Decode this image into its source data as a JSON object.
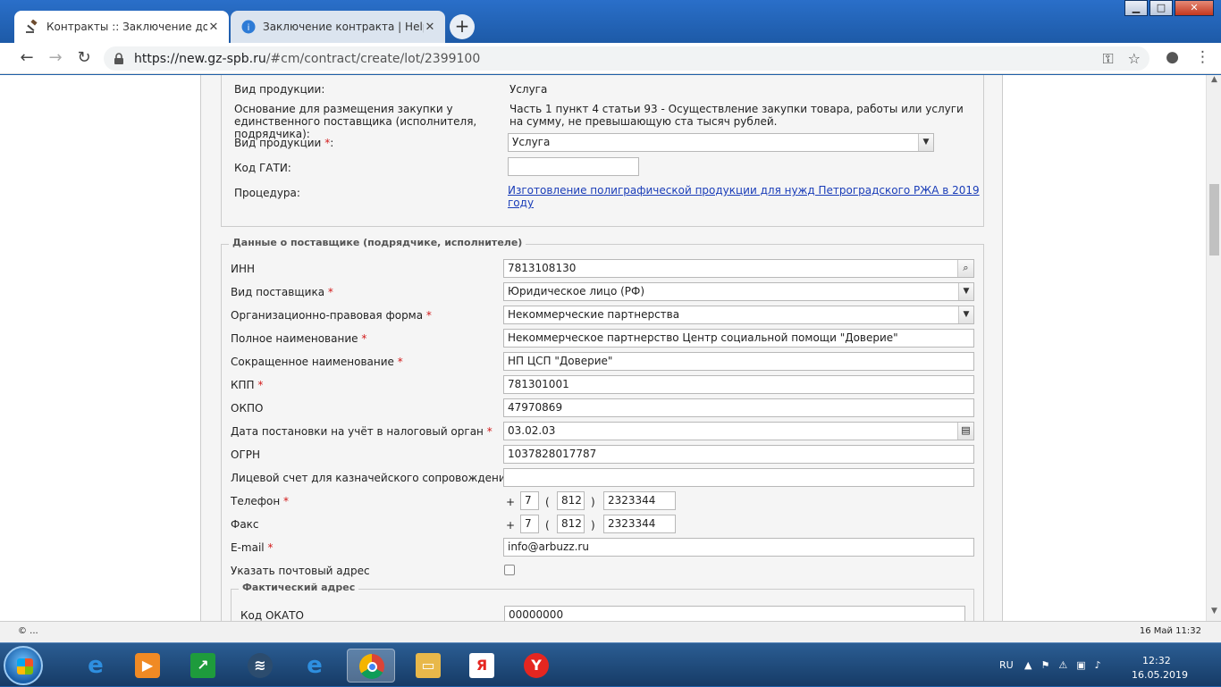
{
  "browser": {
    "tabs": [
      {
        "title": "Контракты :: Заключение догов",
        "close": "✕"
      },
      {
        "title": "Заключение контракта | HelpDe",
        "close": "✕"
      }
    ],
    "new_tab": "+",
    "url_host": "https://new.gz-spb.ru",
    "url_path": "/#cm/contract/create/lot/2399100",
    "window_buttons": {
      "minimize": "▁",
      "maximize": "□",
      "close": "✕"
    }
  },
  "contract": {
    "product_type_label": "Вид продукции:",
    "product_type_value": "Услуга",
    "basis_label": "Основание для размещения закупки у единственного поставщика (исполнителя, подрядчика):",
    "basis_value": "Часть 1 пункт 4 статьи 93 - Осуществление закупки товара, работы или услуги на сумму, не превышающую ста тысяч рублей.",
    "product_type_select_label": "Вид продукции",
    "product_type_select_value": "Услуга",
    "gati_label": "Код ГАТИ:",
    "gati_value": "",
    "procedure_label": "Процедура:",
    "procedure_link": "Изготовление полиграфической продукции для нужд Петроградского РЖА в 2019 году"
  },
  "supplier": {
    "legend": "Данные о поставщике (подрядчике, исполнителе)",
    "inn_label": "ИНН",
    "inn_value": "7813108130",
    "supplier_type_label": "Вид поставщика",
    "supplier_type_value": "Юридическое лицо (РФ)",
    "legal_form_label": "Организационно-правовая форма",
    "legal_form_value": "Некоммерческие партнерства",
    "full_name_label": "Полное наименование",
    "full_name_value": "Некоммерческое партнерство Центр социальной помощи \"Доверие\"",
    "short_name_label": "Сокращенное наименование",
    "short_name_value": "НП ЦСП \"Доверие\"",
    "kpp_label": "КПП",
    "kpp_value": "781301001",
    "okpo_label": "ОКПО",
    "okpo_value": "47970869",
    "tax_date_label": "Дата постановки на учёт в налоговый орган",
    "tax_date_value": "03.02.03",
    "ogrn_label": "ОГРН",
    "ogrn_value": "1037828017787",
    "account_label": "Лицевой счет для казначейского сопровождения",
    "account_value": "",
    "phone_label": "Телефон",
    "phone": {
      "plus": "+",
      "country": "7",
      "open": "(",
      "area": "812",
      "close": ")",
      "number": "2323344"
    },
    "fax_label": "Факс",
    "fax": {
      "plus": "+",
      "country": "7",
      "open": "(",
      "area": "812",
      "close": ")",
      "number": "2323344"
    },
    "email_label": "E-mail",
    "email_value": "info@arbuzz.ru",
    "postal_label": "Указать почтовый адрес",
    "postal_checked": false,
    "actual_address_legend": "Фактический адрес",
    "okato_label": "Код ОКАТО",
    "okato_value": "00000000",
    "required_mark": "*"
  },
  "status": {
    "left": "© ...",
    "right": "16 Май 11:32"
  },
  "taskbar": {
    "language": "RU",
    "time": "12:32",
    "date": "16.05.2019"
  }
}
